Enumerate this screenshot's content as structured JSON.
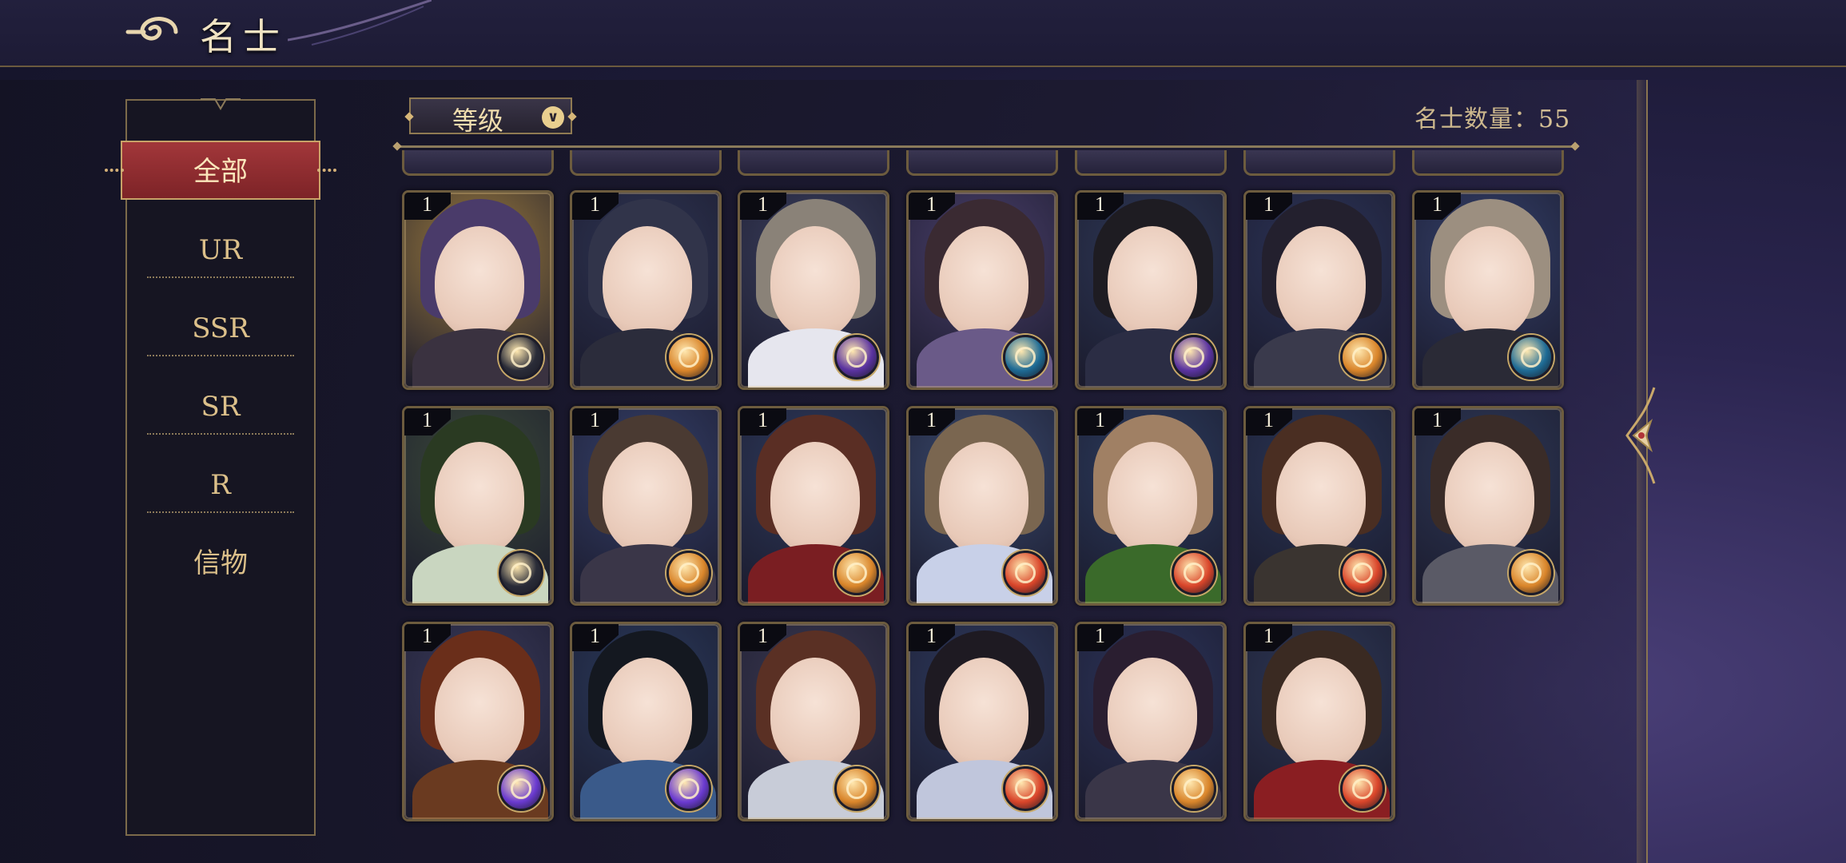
{
  "header": {
    "title": "名士"
  },
  "sidebar": {
    "categories": [
      {
        "label": "全部",
        "active": true
      },
      {
        "label": "UR"
      },
      {
        "label": "SSR"
      },
      {
        "label": "SR"
      },
      {
        "label": "R"
      },
      {
        "label": "信物"
      }
    ]
  },
  "toolbar": {
    "sort_label": "等级",
    "count_label": "名士数量：",
    "count_value": "55"
  },
  "colors": {
    "accent_red": "#8f2b2e",
    "gold": "#c9a86a",
    "panel": "#161522"
  },
  "cards": [
    {
      "level": "1",
      "bg": "#9c7b3e",
      "hair": "#4a3b6a",
      "body": "#3a3240",
      "badge": "dark-element-icon",
      "badge_color": "#2a2c38"
    },
    {
      "level": "1",
      "bg": "#2e3452",
      "hair": "#31344a",
      "body": "#2b2c3b",
      "badge": "fire-element-icon",
      "badge_color": "#d9852a"
    },
    {
      "level": "1",
      "bg": "#3a3e5c",
      "hair": "#8a8278",
      "body": "#e6e6ee",
      "badge": "void-element-icon",
      "badge_color": "#5a33a0"
    },
    {
      "level": "1",
      "bg": "#4a3f6a",
      "hair": "#3a2a32",
      "body": "#6a5a88",
      "badge": "water-element-icon",
      "badge_color": "#1e6b95"
    },
    {
      "level": "1",
      "bg": "#2e3856",
      "hair": "#1e1c22",
      "body": "#2b2d44",
      "badge": "void-element-icon",
      "badge_color": "#5a33a0"
    },
    {
      "level": "1",
      "bg": "#2c3458",
      "hair": "#23202e",
      "body": "#3a3a4c",
      "badge": "fire-element-icon",
      "badge_color": "#d9852a"
    },
    {
      "level": "1",
      "bg": "#34406a",
      "hair": "#9c8f80",
      "body": "#2a2a36",
      "badge": "water-element-icon",
      "badge_color": "#1e6b95"
    },
    {
      "level": "1",
      "bg": "#3c4a3a",
      "hair": "#2a3a22",
      "body": "#c9d6c0",
      "badge": "dark-element-icon",
      "badge_color": "#2a2c38"
    },
    {
      "level": "1",
      "bg": "#35406a",
      "hair": "#4a3a32",
      "body": "#3a3648",
      "badge": "fire-element-icon",
      "badge_color": "#d9852a"
    },
    {
      "level": "1",
      "bg": "#2e3a5c",
      "hair": "#5a2e24",
      "body": "#7a1e22",
      "badge": "fire-element-icon",
      "badge_color": "#d9852a"
    },
    {
      "level": "1",
      "bg": "#3a4a6e",
      "hair": "#7a6650",
      "body": "#c8d0e8",
      "badge": "sun-element-icon",
      "badge_color": "#d9452a"
    },
    {
      "level": "1",
      "bg": "#2c3c5e",
      "hair": "#a08064",
      "body": "#3a6a2a",
      "badge": "sun-element-icon",
      "badge_color": "#d9452a"
    },
    {
      "level": "1",
      "bg": "#2a3656",
      "hair": "#4a2e22",
      "body": "#3a3430",
      "badge": "sun-element-icon",
      "badge_color": "#d9452a"
    },
    {
      "level": "1",
      "bg": "#2e3856",
      "hair": "#3a2c28",
      "body": "#5a5a66",
      "badge": "fire-element-icon",
      "badge_color": "#d9852a"
    },
    {
      "level": "1",
      "bg": "#3a3a5a",
      "hair": "#6a2e1a",
      "body": "#6a3a20",
      "badge": "arcane-element-icon",
      "badge_color": "#6a3ad0"
    },
    {
      "level": "1",
      "bg": "#2a3a5c",
      "hair": "#141820",
      "body": "#3a5a8a",
      "badge": "arcane-element-icon",
      "badge_color": "#6a3ad0"
    },
    {
      "level": "1",
      "bg": "#3a3850",
      "hair": "#5a3024",
      "body": "#c8ccd8",
      "badge": "fire-element-icon",
      "badge_color": "#d9852a"
    },
    {
      "level": "1",
      "bg": "#2e3a5e",
      "hair": "#1e1a22",
      "body": "#c0c6dc",
      "badge": "sun-element-icon",
      "badge_color": "#d9452a"
    },
    {
      "level": "1",
      "bg": "#2c345a",
      "hair": "#2a1e30",
      "body": "#3a3648",
      "badge": "fire-element-icon",
      "badge_color": "#d9852a"
    },
    {
      "level": "1",
      "bg": "#2e3856",
      "hair": "#3a2a22",
      "body": "#8a1e22",
      "badge": "sun-element-icon",
      "badge_color": "#d9452a"
    }
  ]
}
